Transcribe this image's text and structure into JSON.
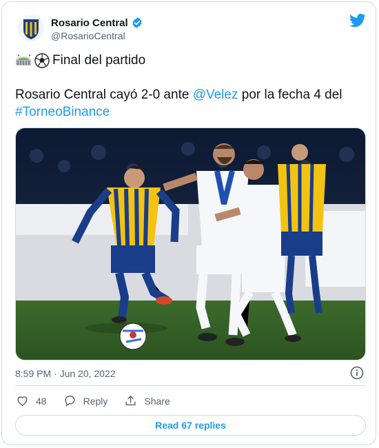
{
  "account": {
    "name": "Rosario Central",
    "handle": "@RosarioCentral"
  },
  "tweet": {
    "line1": "Final del partido",
    "text_part1": "Rosario Central cayó 2-0 ante ",
    "mention": "@Velez",
    "text_part2": " por la fecha 4 del ",
    "hashtag": "#TorneoBinance",
    "timestamp": "8:59 PM · Jun 20, 2022"
  },
  "actions": {
    "likes": "48",
    "reply_label": "Reply",
    "share_label": "Share"
  },
  "read_replies": "Read 67 replies",
  "icons": {
    "verified": "verified-badge-icon",
    "bird": "twitter-bird-icon",
    "stadium": "stadium-emoji",
    "ball": "soccer-ball-emoji",
    "info": "info-icon",
    "like": "heart-icon",
    "reply": "speech-bubble-icon",
    "share": "share-upload-icon"
  },
  "colors": {
    "accent": "#1d9bf0",
    "text": "#0f1419",
    "muted": "#536471",
    "border": "#cfd9de"
  }
}
